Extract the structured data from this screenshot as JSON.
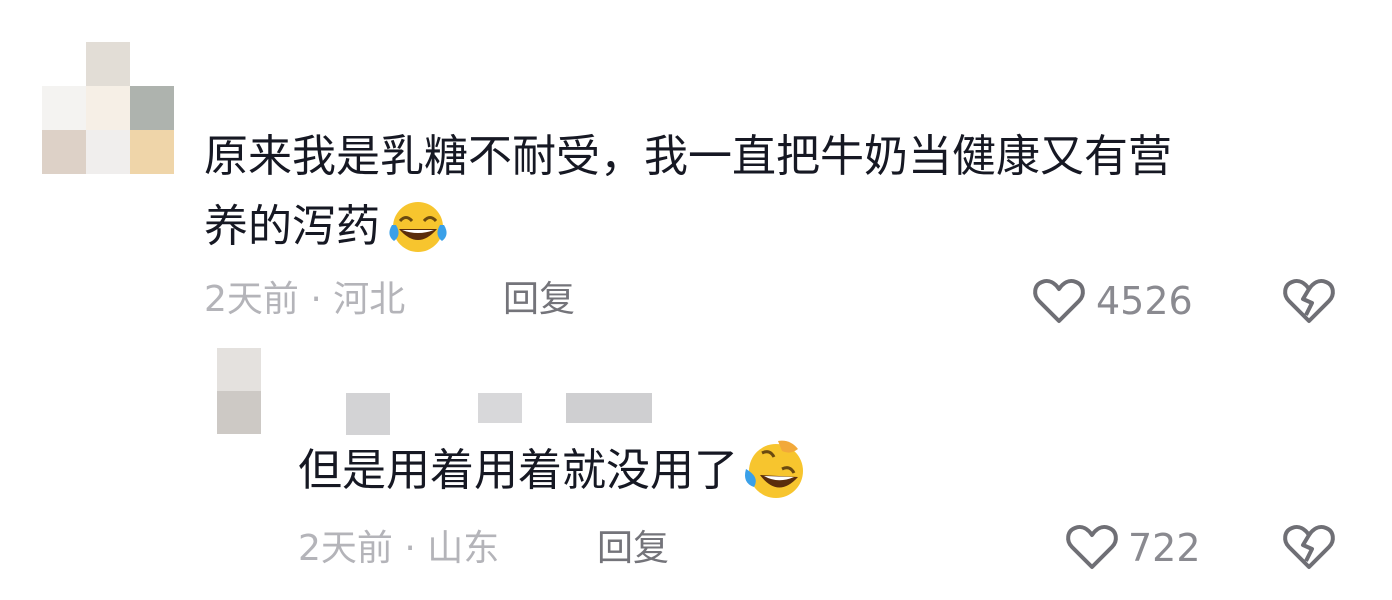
{
  "comments": [
    {
      "text_line1": "原来我是乳糖不耐受，我一直把牛奶当健康又有营",
      "text_line2": "养的泻药",
      "emoji": "laugh-cry-emoji",
      "time": "2天前",
      "location": "河北",
      "separator": "·",
      "reply_label": "回复",
      "likes": "4526"
    },
    {
      "text": "但是用着用着就没用了",
      "emoji": "rofl-emoji",
      "time": "2天前",
      "location": "山东",
      "separator": "·",
      "reply_label": "回复",
      "likes": "722"
    }
  ],
  "icons": {
    "like": "heart-outline-icon",
    "dislike": "broken-heart-icon"
  },
  "colors": {
    "text": "#161823",
    "meta": "#b4b4b9",
    "reply": "#74747a",
    "icon": "#6f6f75"
  }
}
